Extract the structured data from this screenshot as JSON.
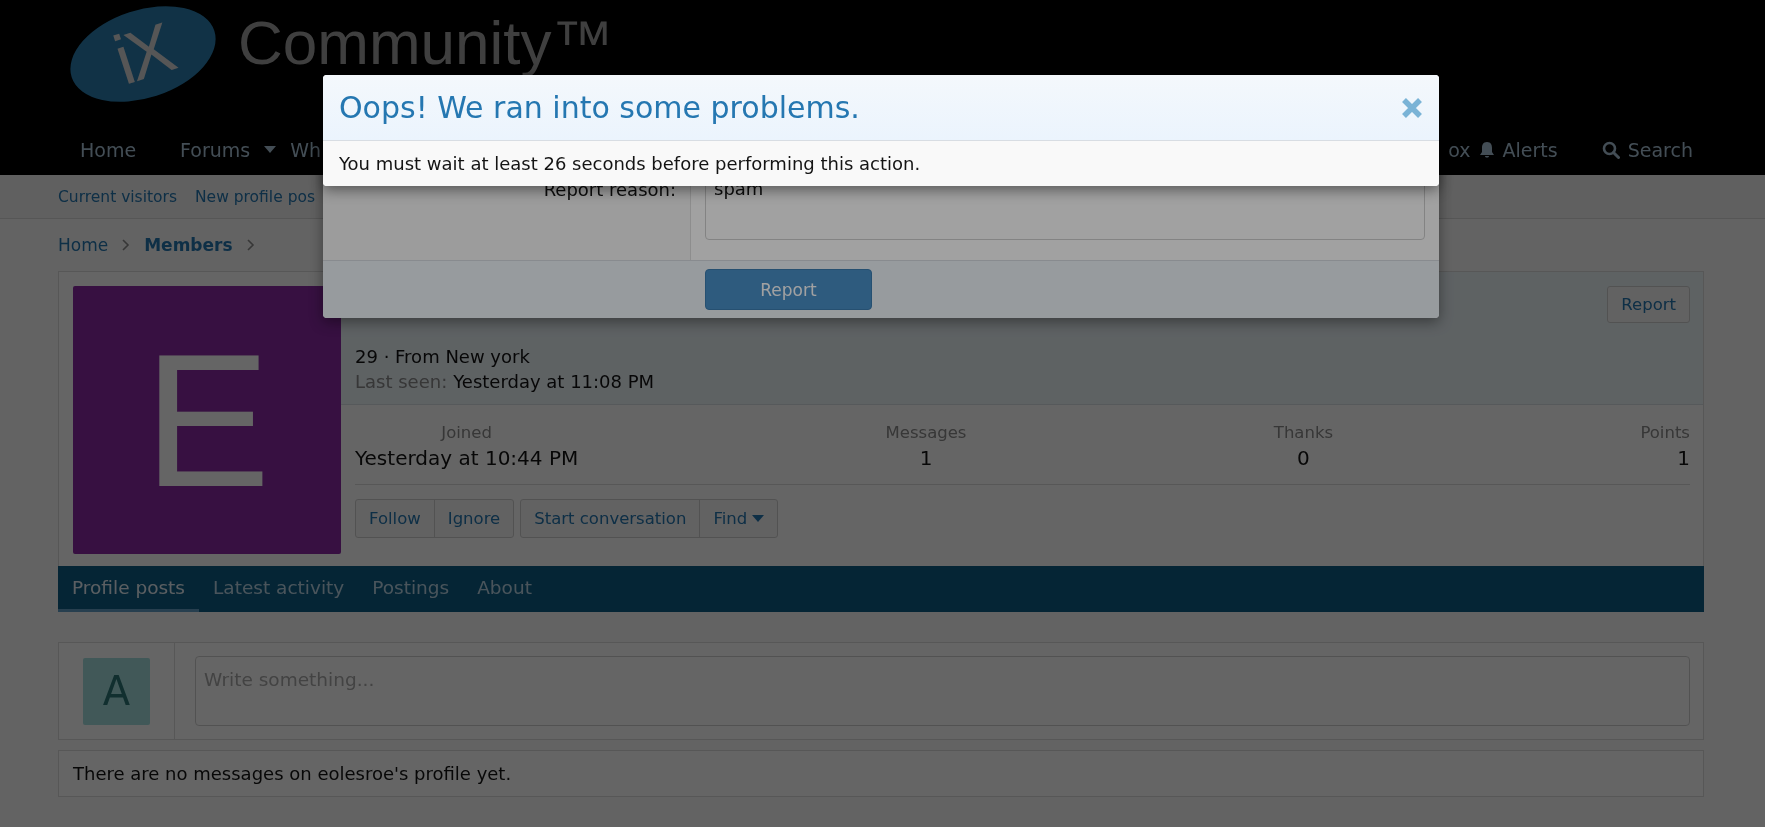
{
  "header": {
    "logo": {
      "mark": "iX",
      "name": "Community",
      "trademark": "™"
    },
    "nav": [
      {
        "label": "Home",
        "kind": "link"
      },
      {
        "label": "Forums",
        "kind": "dropdown"
      },
      {
        "label": "Wh",
        "kind": "link"
      }
    ],
    "nav_right": [
      {
        "label": "ox"
      },
      {
        "label": "Alerts"
      },
      {
        "label": "Search"
      }
    ]
  },
  "subnav": [
    "Current visitors",
    "New profile pos"
  ],
  "breadcrumb": [
    {
      "label": "Home",
      "current": false
    },
    {
      "label": "Members",
      "current": true
    }
  ],
  "profile": {
    "avatar_letter": "E",
    "report_button": "Report",
    "details": "29 · From New york",
    "last_seen_label": "Last seen:",
    "last_seen_value": "Yesterday at 11:08 PM",
    "stats": [
      {
        "label": "Joined",
        "value": "Yesterday at 10:44 PM"
      },
      {
        "label": "Messages",
        "value": "1"
      },
      {
        "label": "Thanks",
        "value": "0"
      },
      {
        "label": "Points",
        "value": "1"
      }
    ],
    "button_groups": [
      [
        {
          "label": "Follow",
          "dropdown": false
        },
        {
          "label": "Ignore",
          "dropdown": false
        }
      ],
      [
        {
          "label": "Start conversation",
          "dropdown": false
        },
        {
          "label": "Find",
          "dropdown": true
        }
      ]
    ],
    "tabs": [
      {
        "label": "Profile posts",
        "selected": true
      },
      {
        "label": "Latest activity",
        "selected": false
      },
      {
        "label": "Postings",
        "selected": false
      },
      {
        "label": "About",
        "selected": false
      }
    ]
  },
  "post_form": {
    "avatar_letter": "A",
    "placeholder": "Write something..."
  },
  "empty_message": "There are no messages on eolesroe's profile yet.",
  "report_dialog": {
    "field_label": "Report reason:",
    "field_value": "spam",
    "submit": "Report"
  },
  "error_dialog": {
    "title": "Oops! We ran into some problems.",
    "message": "You must wait at least 26 seconds before performing this action."
  }
}
